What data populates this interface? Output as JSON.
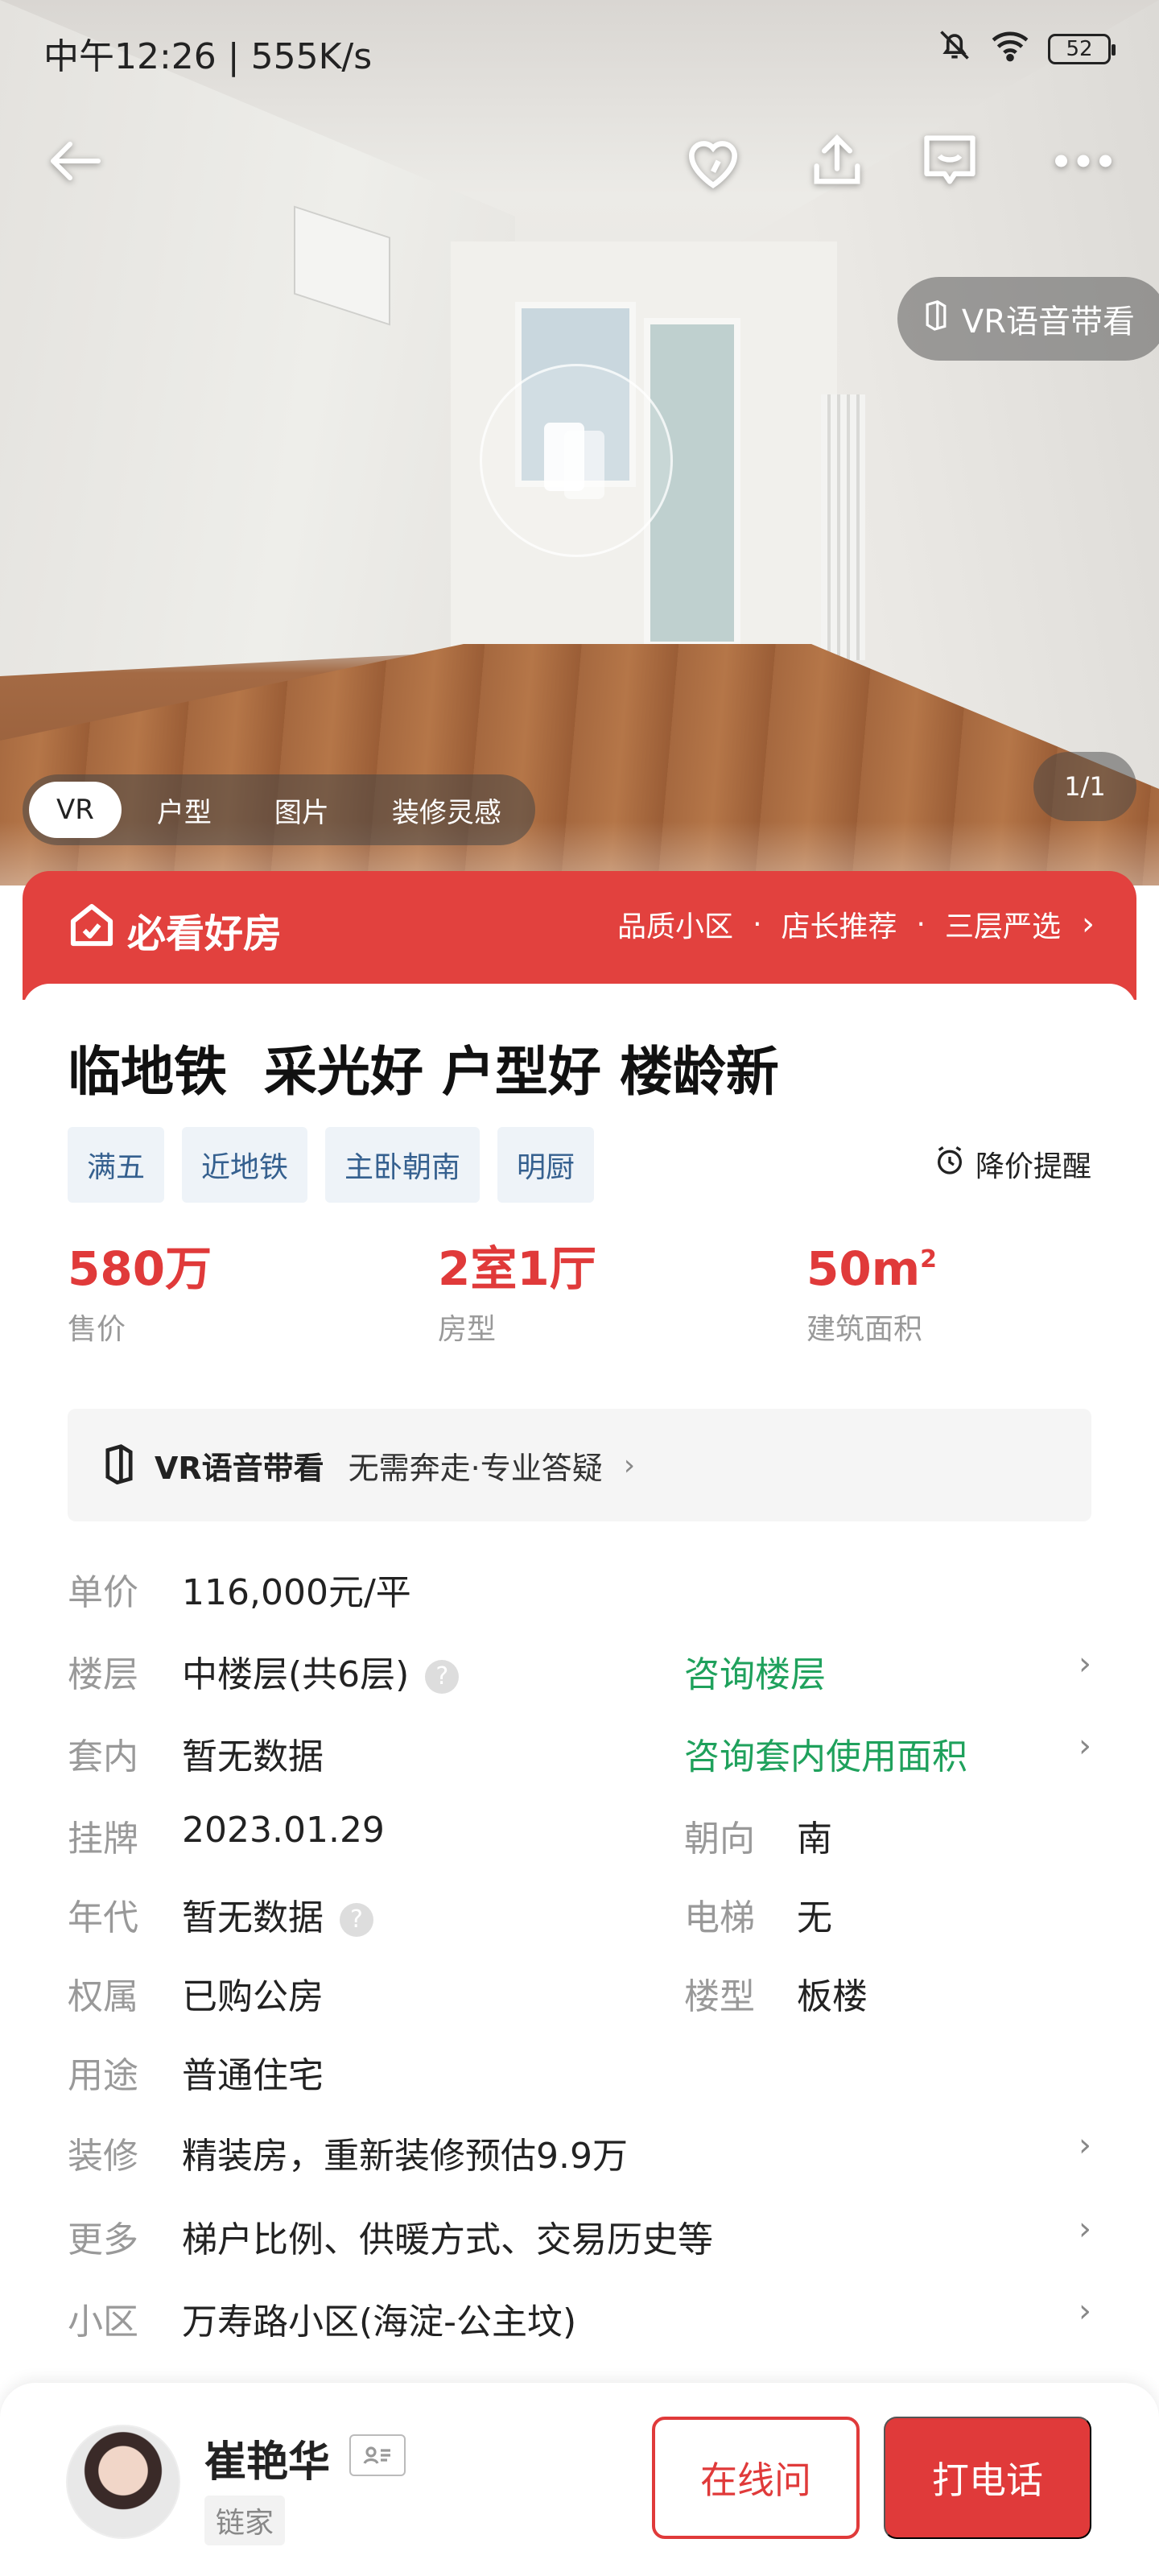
{
  "status_bar": {
    "time": "中午12:26 | 555K/s",
    "battery": "52"
  },
  "hero": {
    "vr_voice_label": "VR语音带看",
    "media_tabs": [
      "VR",
      "户型",
      "图片",
      "装修灵感"
    ],
    "active_tab": "VR",
    "pager": "1/1"
  },
  "banner": {
    "logo_text": "必看好房",
    "links": [
      "品质小区",
      "店长推荐",
      "三层严选"
    ],
    "dot": "·",
    "chevron": "›",
    "color": "#e2413e"
  },
  "listing": {
    "title": "临地铁  采光好 户型好 楼龄新",
    "tags": [
      "满五",
      "近地铁",
      "主卧朝南",
      "明厨"
    ],
    "price_alert": "降价提醒",
    "kpis": [
      {
        "value": "580万",
        "label": "售价"
      },
      {
        "value": "2室1厅",
        "label": "房型"
      },
      {
        "value": "50m",
        "sup": "2",
        "label": "建筑面积"
      }
    ],
    "vr_row": {
      "title": "VR语音带看",
      "subtitle": "无需奔走·专业答疑"
    },
    "details": {
      "unit_price": {
        "label": "单价",
        "value": "116,000元/平"
      },
      "floor": {
        "label": "楼层",
        "value": "中楼层(共6层)",
        "link": "咨询楼层"
      },
      "inner": {
        "label": "套内",
        "value": "暂无数据",
        "link": "咨询套内使用面积"
      },
      "listed": {
        "label": "挂牌",
        "value": "2023.01.29"
      },
      "orientation": {
        "label": "朝向",
        "value": "南"
      },
      "year": {
        "label": "年代",
        "value": "暂无数据"
      },
      "elevator": {
        "label": "电梯",
        "value": "无"
      },
      "ownership": {
        "label": "权属",
        "value": "已购公房"
      },
      "building_type": {
        "label": "楼型",
        "value": "板楼"
      },
      "usage": {
        "label": "用途",
        "value": "普通住宅"
      },
      "decoration": {
        "label": "装修",
        "value": "精装房，重新装修预估9.9万"
      },
      "more": {
        "label": "更多",
        "value": "梯户比例、供暖方式、交易历史等"
      },
      "community": {
        "label": "小区",
        "value": "万寿路小区(海淀-公主坟)"
      }
    },
    "accent_red": "#e03a3a",
    "link_green": "#1fa15c",
    "tag_blue": "#35608f"
  },
  "agent": {
    "name": "崔艳华",
    "company": "链家",
    "btn_online": "在线问",
    "btn_call": "打电话"
  }
}
